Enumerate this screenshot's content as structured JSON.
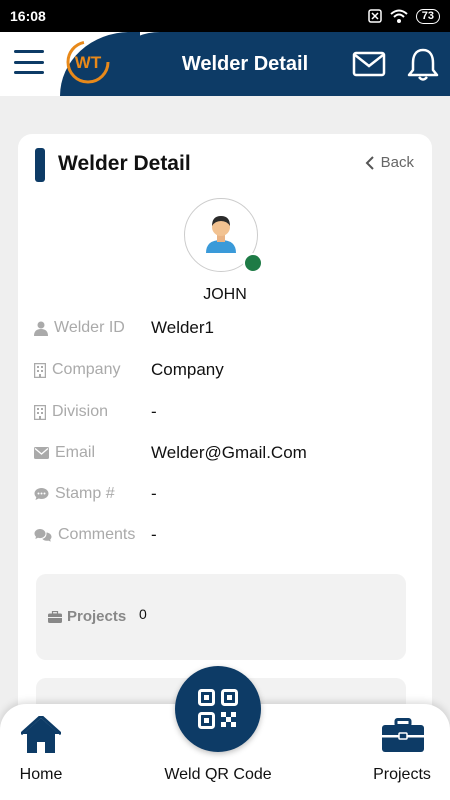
{
  "status_bar": {
    "time": "16:08",
    "battery": "73"
  },
  "header": {
    "title": "Welder Detail",
    "logo_text": "WT"
  },
  "card": {
    "title": "Welder Detail",
    "back_label": "Back",
    "user_name": "JOHN",
    "fields": [
      {
        "label": "Welder ID",
        "value": "Welder1",
        "icon": "user-icon"
      },
      {
        "label": "Company",
        "value": "Company",
        "icon": "building-icon"
      },
      {
        "label": "Division",
        "value": "-",
        "icon": "building-icon"
      },
      {
        "label": "Email",
        "value": "Welder@Gmail.Com",
        "icon": "envelope-icon"
      },
      {
        "label": "Stamp #",
        "value": "-",
        "icon": "speech-bubble-icon"
      },
      {
        "label": "Comments",
        "value": "-",
        "icon": "comments-icon"
      }
    ],
    "projects": {
      "label": "Projects",
      "count": "0"
    }
  },
  "bottom_nav": {
    "home_label": "Home",
    "qr_label": "Weld QR Code",
    "projects_label": "Projects"
  },
  "colors": {
    "primary": "#0d3b66",
    "online": "#1e7b46",
    "accent_orange": "#e8891a"
  }
}
